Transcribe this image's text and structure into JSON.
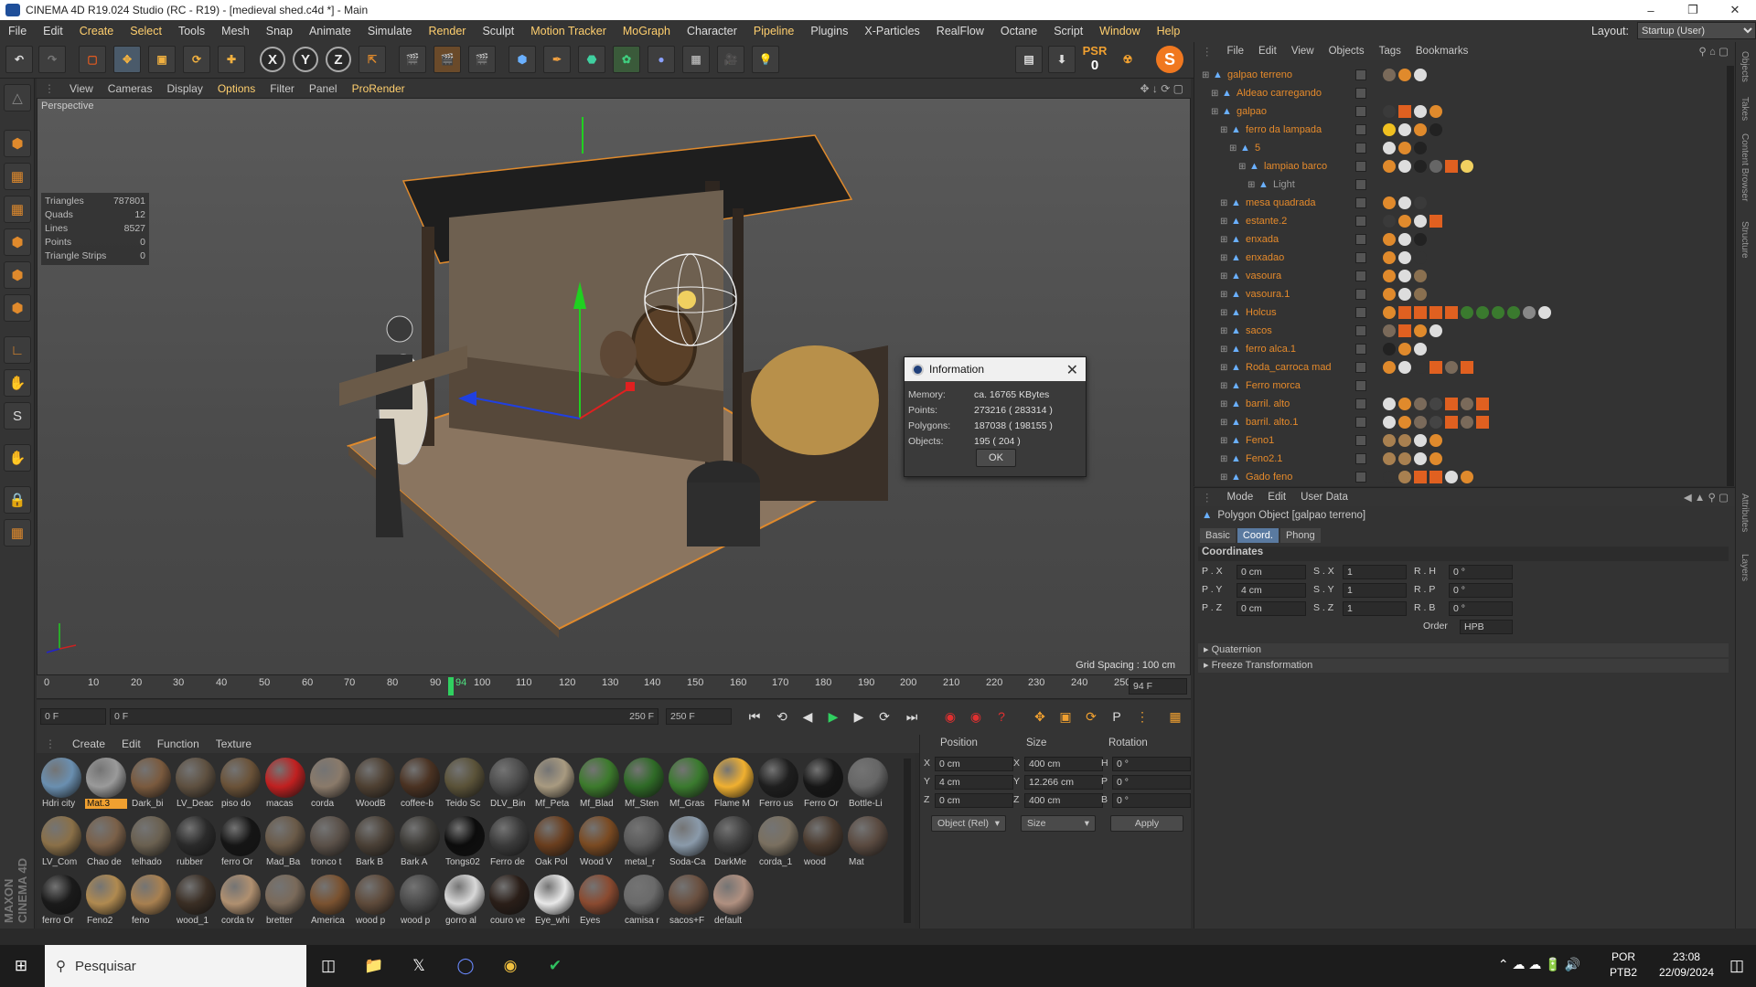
{
  "window": {
    "title": "CINEMA 4D R19.024 Studio (RC - R19) - [medieval shed.c4d *] - Main"
  },
  "menu": {
    "items": [
      "File",
      "Edit",
      "Create",
      "Select",
      "Tools",
      "Mesh",
      "Snap",
      "Animate",
      "Simulate",
      "Render",
      "Sculpt",
      "Motion Tracker",
      "MoGraph",
      "Character",
      "Pipeline",
      "Plugins",
      "X-Particles",
      "RealFlow",
      "Octane",
      "Script",
      "Window",
      "Help"
    ],
    "layout_label": "Layout:",
    "layout_value": "Startup (User)"
  },
  "toolbar": {
    "psr_label": "PSR",
    "psr_value": "0"
  },
  "viewport": {
    "menu": [
      "View",
      "Cameras",
      "Display",
      "Options",
      "Filter",
      "Panel",
      "ProRender"
    ],
    "label": "Perspective",
    "stats": [
      {
        "k": "Triangles",
        "v": "787801"
      },
      {
        "k": "Quads",
        "v": "12"
      },
      {
        "k": "Lines",
        "v": "8527"
      },
      {
        "k": "Points",
        "v": "0"
      },
      {
        "k": "Triangle Strips",
        "v": "0"
      }
    ],
    "grid_spacing": "Grid Spacing : 100 cm"
  },
  "info_dialog": {
    "title": "Information",
    "memory_label": "Memory:",
    "memory_value": "ca. 16765 KBytes",
    "points_label": "Points:",
    "points_value": "273216 ( 283314 )",
    "polygons_label": "Polygons:",
    "polygons_value": "187038 ( 198155 )",
    "objects_label": "Objects:",
    "objects_value": "195 ( 204 )",
    "ok": "OK"
  },
  "timeline": {
    "ticks": [
      "0",
      "10",
      "20",
      "30",
      "40",
      "50",
      "60",
      "70",
      "80",
      "90",
      "94",
      "100",
      "110",
      "120",
      "130",
      "140",
      "150",
      "160",
      "170",
      "180",
      "190",
      "200",
      "210",
      "220",
      "230",
      "240",
      "250"
    ],
    "current_frame": "94 F",
    "start_field": "0 F",
    "range_start": "0 F",
    "range_end": "250 F",
    "end_field": "250 F"
  },
  "materials": {
    "menu": [
      "Create",
      "Edit",
      "Function",
      "Texture"
    ],
    "items": [
      {
        "name": "Hdri city",
        "color": "#6a8fb0"
      },
      {
        "name": "Mat.3",
        "color": "#9a9a9a"
      },
      {
        "name": "Dark_bi",
        "color": "#7a5a3e"
      },
      {
        "name": "LV_Deac",
        "color": "#5e5040"
      },
      {
        "name": "piso do",
        "color": "#6a5238"
      },
      {
        "name": "macas",
        "color": "#c02020"
      },
      {
        "name": "corda",
        "color": "#8a7a6a"
      },
      {
        "name": "WoodB",
        "color": "#4e4032"
      },
      {
        "name": "coffee-b",
        "color": "#4a3222"
      },
      {
        "name": "Teido Sc",
        "color": "#5a5238"
      },
      {
        "name": "DLV_Bin",
        "color": "#4c4c4c"
      },
      {
        "name": "Mf_Peta",
        "color": "#a89a80"
      },
      {
        "name": "Mf_Blad",
        "color": "#3c7a2c"
      },
      {
        "name": "Mf_Sten",
        "color": "#2e6a26"
      },
      {
        "name": "Mf_Gras",
        "color": "#3a7a2e"
      },
      {
        "name": "Flame M",
        "color": "#f0b030"
      },
      {
        "name": "Ferro us",
        "color": "#1e1e1e"
      },
      {
        "name": "Ferro Or",
        "color": "#161616"
      },
      {
        "name": "Bottle-Li",
        "color": "#666"
      },
      {
        "name": "LV_Com",
        "color": "#8a7048"
      },
      {
        "name": "Chao de",
        "color": "#7a6048"
      },
      {
        "name": "telhado",
        "color": "#6a6050"
      },
      {
        "name": "rubber",
        "color": "#2a2a2a"
      },
      {
        "name": "ferro Or",
        "color": "#151515"
      },
      {
        "name": "Mad_Ba",
        "color": "#6a5a48"
      },
      {
        "name": "tronco t",
        "color": "#5a5048"
      },
      {
        "name": "Bark B",
        "color": "#4a4036"
      },
      {
        "name": "Bark A",
        "color": "#3c3a36"
      },
      {
        "name": "Tongs02",
        "color": "#0c0c0c"
      },
      {
        "name": "Ferro de",
        "color": "#3a3a3a"
      },
      {
        "name": "Oak Pol",
        "color": "#6a3e1e"
      },
      {
        "name": "Wood V",
        "color": "#7a4a22"
      },
      {
        "name": "metal_r",
        "color": "#5a5a5a"
      },
      {
        "name": "Soda-Ca",
        "color": "#8a9aaa"
      },
      {
        "name": "DarkMe",
        "color": "#3e3e3e"
      },
      {
        "name": "corda_1",
        "color": "#7a7060"
      },
      {
        "name": "wood",
        "color": "#4a3a2e"
      },
      {
        "name": "Mat",
        "color": "#5a4a40"
      },
      {
        "name": "ferro Or",
        "color": "#1a1a1a"
      },
      {
        "name": "Feno2",
        "color": "#b08a50"
      },
      {
        "name": "feno",
        "color": "#a88050"
      },
      {
        "name": "wood_1",
        "color": "#3a2e24"
      },
      {
        "name": "corda tv",
        "color": "#b09070"
      },
      {
        "name": "bretter",
        "color": "#7a6a5a"
      },
      {
        "name": "America",
        "color": "#7a5230"
      },
      {
        "name": "wood p",
        "color": "#5e4a3a"
      },
      {
        "name": "wood p",
        "color": "#4a4a4a"
      },
      {
        "name": "gorro al",
        "color": "#d8d8d8"
      },
      {
        "name": "couro ve",
        "color": "#2a1e18"
      },
      {
        "name": "Eye_whi",
        "color": "#e8e8e8"
      },
      {
        "name": "Eyes",
        "color": "#8a4a30"
      },
      {
        "name": "camisa r",
        "color": "#6a6a6a"
      },
      {
        "name": "sacos+F",
        "color": "#6a5040"
      },
      {
        "name": "default",
        "color": "#b09080"
      }
    ],
    "selected": "Mat.3"
  },
  "coords": {
    "position_h": "Position",
    "size_h": "Size",
    "rotation_h": "Rotation",
    "px_l": "X",
    "px": "0 cm",
    "py_l": "Y",
    "py": "4 cm",
    "pz_l": "Z",
    "pz": "0 cm",
    "sx_l": "X",
    "sx": "400 cm",
    "sy_l": "Y",
    "sy": "12.266 cm",
    "sz_l": "Z",
    "sz": "400 cm",
    "rh_l": "H",
    "rh": "0 °",
    "rp_l": "P",
    "rp": "0 °",
    "rb_l": "B",
    "rb": "0 °",
    "mode": "Object (Rel)",
    "size_mode": "Size",
    "apply": "Apply"
  },
  "objects": {
    "menu": [
      "File",
      "Edit",
      "View",
      "Objects",
      "Tags",
      "Bookmarks"
    ],
    "rows": [
      {
        "name": "galpao terreno",
        "color": "#e58a2b"
      },
      {
        "name": "Aldeao carregando",
        "color": "#e58a2b"
      },
      {
        "name": "galpao",
        "color": "#e58a2b"
      },
      {
        "name": "ferro da lampada",
        "color": "#e58a2b"
      },
      {
        "name": "5",
        "color": "#e58a2b"
      },
      {
        "name": "lampiao barco",
        "color": "#e58a2b"
      },
      {
        "name": "Light",
        "color": "#9a9a9a"
      },
      {
        "name": "mesa quadrada",
        "color": "#e58a2b"
      },
      {
        "name": "estante.2",
        "color": "#e58a2b"
      },
      {
        "name": "enxada",
        "color": "#e58a2b"
      },
      {
        "name": "enxadao",
        "color": "#e58a2b"
      },
      {
        "name": "vasoura",
        "color": "#e58a2b"
      },
      {
        "name": "vasoura.1",
        "color": "#e58a2b"
      },
      {
        "name": "Holcus",
        "color": "#e58a2b"
      },
      {
        "name": "sacos",
        "color": "#e58a2b"
      },
      {
        "name": "ferro alca.1",
        "color": "#e58a2b"
      },
      {
        "name": "Roda_carroca mad",
        "color": "#e58a2b"
      },
      {
        "name": "Ferro morca",
        "color": "#e58a2b"
      },
      {
        "name": "barril. alto",
        "color": "#e58a2b"
      },
      {
        "name": "barril. alto.1",
        "color": "#e58a2b"
      },
      {
        "name": "Feno1",
        "color": "#e58a2b"
      },
      {
        "name": "Feno2.1",
        "color": "#e58a2b"
      },
      {
        "name": "Gado feno",
        "color": "#e58a2b"
      }
    ]
  },
  "attributes": {
    "menu": [
      "Mode",
      "Edit",
      "User Data"
    ],
    "object_title": "Polygon Object [galpao terreno]",
    "tabs": [
      "Basic",
      "Coord.",
      "Phong"
    ],
    "active_tab": "Coord.",
    "section": "Coordinates",
    "pxl": "P . X",
    "px": "0 cm",
    "pyl": "P . Y",
    "py": "4 cm",
    "pzl": "P . Z",
    "pz": "0 cm",
    "sxl": "S . X",
    "sx": "1",
    "syl": "S . Y",
    "sy": "1",
    "szl": "S . Z",
    "sz": "1",
    "rhl": "R . H",
    "rh": "0 °",
    "rpl": "R . P",
    "rp": "0 °",
    "rbl": "R . B",
    "rb": "0 °",
    "order_label": "Order",
    "order": "HPB",
    "quaternion": "Quaternion",
    "freeze": "Freeze Transformation"
  },
  "right_strip": [
    "Objects",
    "Takes",
    "Content Browser",
    "Structure",
    "Attributes",
    "Layers"
  ],
  "taskbar": {
    "search": "Pesquisar",
    "lang1": "POR",
    "lang2": "PTB2",
    "time": "23:08",
    "date": "22/09/2024"
  },
  "maxon": "MAXON CINEMA 4D"
}
